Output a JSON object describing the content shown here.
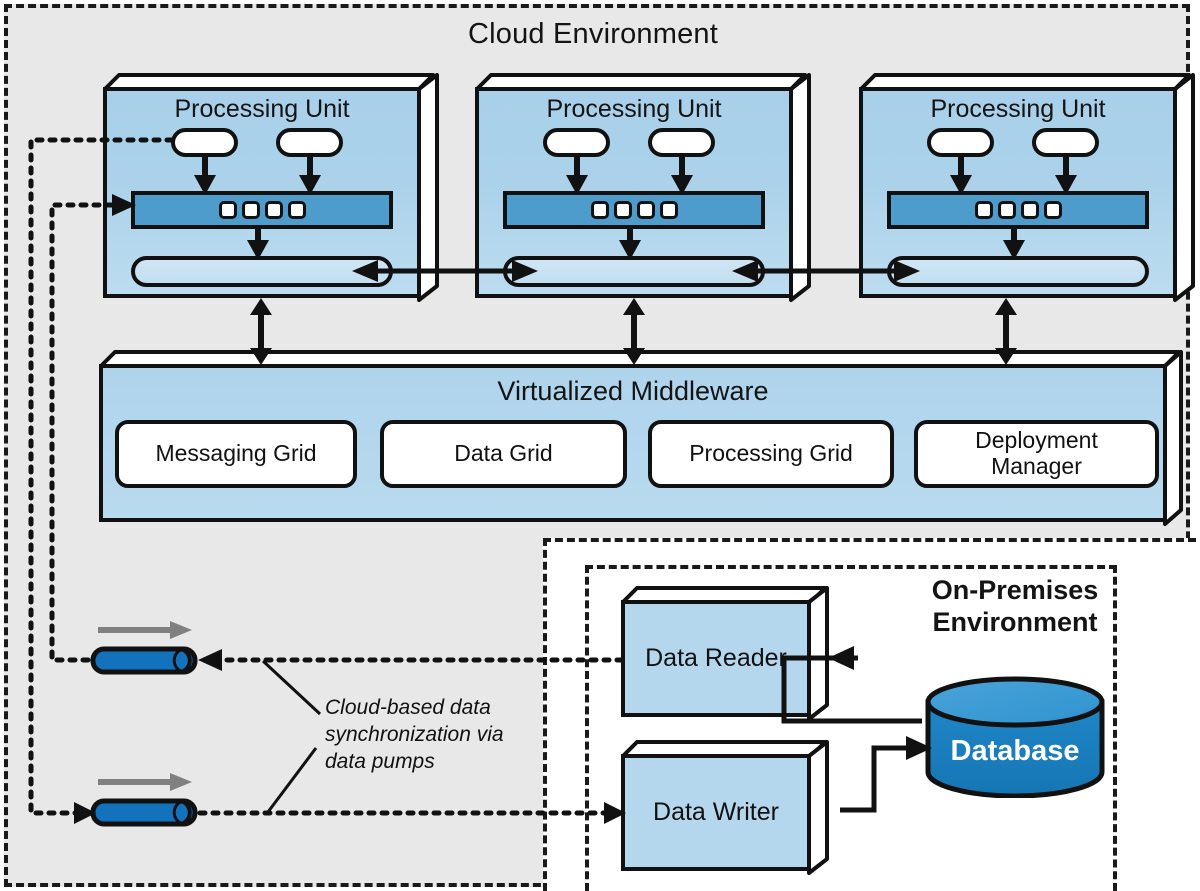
{
  "cloud": {
    "title": "Cloud Environment"
  },
  "onprem": {
    "title_line1": "On-Premises",
    "title_line2": "Environment"
  },
  "processing_units": [
    {
      "title": "Processing Unit"
    },
    {
      "title": "Processing Unit"
    },
    {
      "title": "Processing Unit"
    }
  ],
  "middleware": {
    "title": "Virtualized Middleware",
    "grids": [
      {
        "label": "Messaging Grid"
      },
      {
        "label": "Data Grid"
      },
      {
        "label": "Processing Grid"
      },
      {
        "label_line1": "Deployment",
        "label_line2": "Manager"
      }
    ]
  },
  "onprem_nodes": [
    {
      "label": "Data Reader"
    },
    {
      "label": "Data Writer"
    }
  ],
  "database": {
    "label": "Database"
  },
  "annotation": {
    "line1": "Cloud-based data",
    "line2": "synchronization via",
    "line3": "data pumps"
  },
  "colors": {
    "cloud_background": "#e8e8e8",
    "unit_fill": "#abd2ea",
    "cache_fill": "#4e9ccb",
    "database_fill": "#1a7fc2",
    "pump_fill": "#1272bb",
    "outline": "#111111",
    "onprem_background": "#ffffff"
  }
}
